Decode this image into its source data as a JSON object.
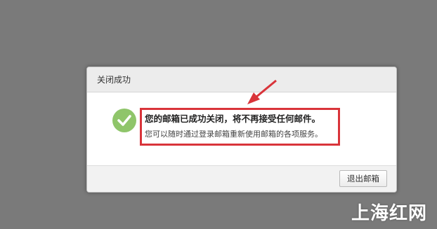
{
  "dialog": {
    "title": "关闭成功",
    "message_title": "您的邮箱已成功关闭，将不再接受任何邮件。",
    "message_sub": "您可以随时通过登录邮箱重新使用邮箱的各项服务。",
    "exit_button_label": "退出邮箱",
    "icon": "check-circle-icon"
  },
  "watermark": "上海红网",
  "colors": {
    "backdrop": "#7a7a7a",
    "success_green": "#8fc56a",
    "highlight_red": "#d9343a"
  }
}
